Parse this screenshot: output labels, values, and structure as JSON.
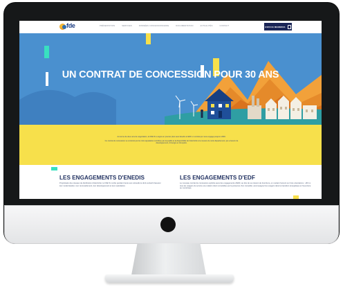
{
  "nav": {
    "logo": "fde",
    "links": [
      "PRÉSENTATION",
      "SERVICES",
      "DONNÉES CONCESSIONNAIRE",
      "DOCUMENTATION",
      "ACTUALITÉS",
      "CONTACT"
    ],
    "cta": "ESPACE MEMBRES"
  },
  "hero": {
    "title": "UN CONTRAT DE CONCESSION POUR 30 ANS"
  },
  "intro": {
    "p1": "Au terme de deux ans de négociation, le FDE 5x a signé en premier plan avec Enedis et EDF un contrat qui nous engage jusqu'en 2049.",
    "p2": "Ce contrat de concession se construit par les trois signataires contribue par la qualité et la disponibilité de l'électricité à la mesure de notre département, qui a besoin de développement, d'énergie et d'emplois."
  },
  "sections": {
    "enedis": {
      "title": "LES ENGAGEMENTS D'ENEDIS",
      "body": "Propriétaire des réseaux de distribution d'électricité, le FDE 5x confie pendant trente ans à Enedis le droit exclusif d'assurer leur modernisation, leur renouvellement, leur développement et leur exploitation."
    },
    "edf": {
      "title": "LES ENGAGEMENTS D'EDF",
      "body": "Le nouveau contrat de concession explicite aussi les engagements d'EDF, au titre de sa mission de fourniture, en mettant l'accent sur trois orientations : offrir à tous les usagers du service une relation client consolidée par la présence d'un conseiller, accompagner les usagers dans la transition énergétique et l'ouverture au numérique."
    }
  },
  "colors": {
    "hero_blue": "#4a90cf",
    "band_yellow": "#f7e04b",
    "navy": "#1a2557",
    "accent_teal": "#39e0c0"
  }
}
